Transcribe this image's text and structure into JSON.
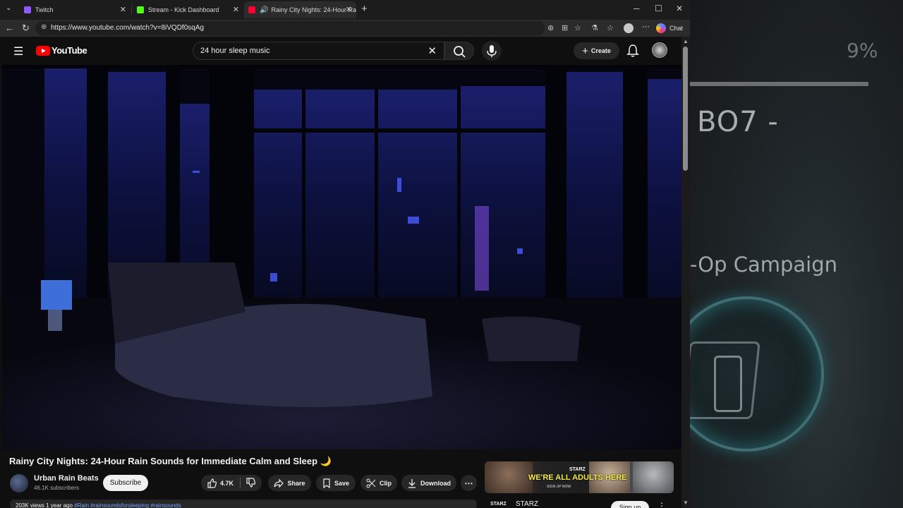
{
  "tabs": [
    {
      "label": "Twitch"
    },
    {
      "label": "Stream - Kick Dashboard"
    },
    {
      "label": "Rainy City Nights: 24-Hour Ra"
    }
  ],
  "address": {
    "url": "https://www.youtube.com/watch?v=8iVQDf0sqAg"
  },
  "chat_label": "Chat",
  "youtube": {
    "logo_text": "YouTube",
    "search_query": "24 hour sleep music",
    "create_label": "Create"
  },
  "video": {
    "title": "Rainy City Nights: 24-Hour Rain Sounds for Immediate Calm and Sleep 🌙",
    "channel": "Urban Rain Beats",
    "subscribers": "46.1K subscribers",
    "subscribe_label": "Subscribe",
    "likes": "4.7K",
    "share_label": "Share",
    "save_label": "Save",
    "clip_label": "Clip",
    "download_label": "Download",
    "meta_views": "203K views  1 year ago",
    "meta_tags": "#Rain #rainsoundsforsleeping #rainsounds"
  },
  "ad": {
    "headline": "WE'RE ALL ADULTS HERE",
    "brand": "STARZ",
    "small_signup": "SIGN UP NOW",
    "signup_label": "Sign up"
  },
  "background_app": {
    "percent": "9%",
    "title": "BO7 -",
    "subtitle": "-Op Campaign"
  }
}
